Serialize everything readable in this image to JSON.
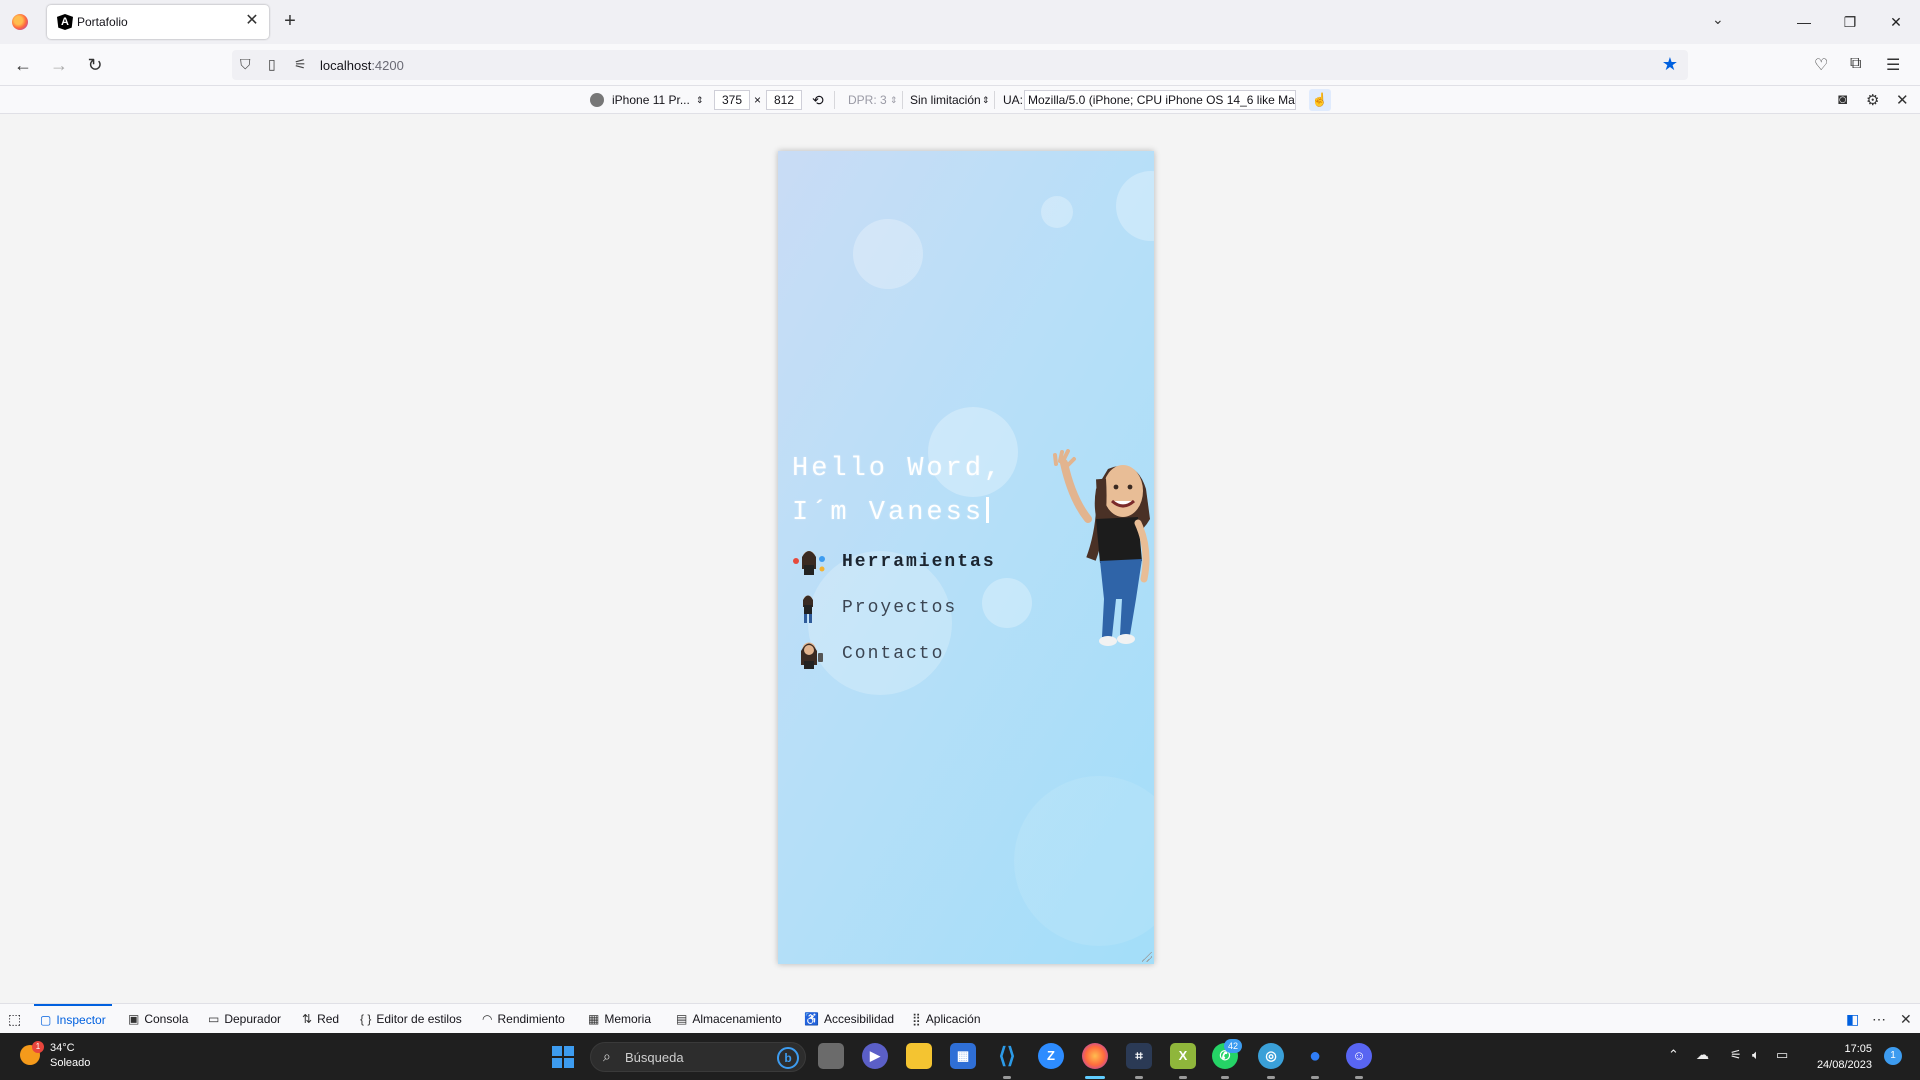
{
  "browser": {
    "tab_title": "Portafolio",
    "url_host": "localhost",
    "url_port": ":4200"
  },
  "rdm": {
    "device": "iPhone 11 Pr...",
    "width": "375",
    "times": "×",
    "height": "812",
    "dpr": "DPR: 3",
    "throttle": "Sin limitación",
    "ua_label": "UA:",
    "ua_value": "Mozilla/5.0 (iPhone; CPU iPhone OS 14_6 like Mac"
  },
  "page": {
    "hello_line1": "Hello Word,",
    "hello_line2": "I´m Vaness",
    "menu": [
      {
        "label": "Herramientas"
      },
      {
        "label": "Proyectos"
      },
      {
        "label": "Contacto"
      }
    ]
  },
  "devtools": {
    "tabs": [
      "Inspector",
      "Consola",
      "Depurador",
      "Red",
      "Editor de estilos",
      "Rendimiento",
      "Memoria",
      "Almacenamiento",
      "Accesibilidad",
      "Aplicación"
    ]
  },
  "taskbar": {
    "temp": "34°C",
    "weather": "Soleado",
    "weather_badge": "1",
    "search_placeholder": "Búsqueda",
    "whatsapp_badge": "42",
    "time": "17:05",
    "date": "24/08/2023",
    "notifications": "1"
  }
}
